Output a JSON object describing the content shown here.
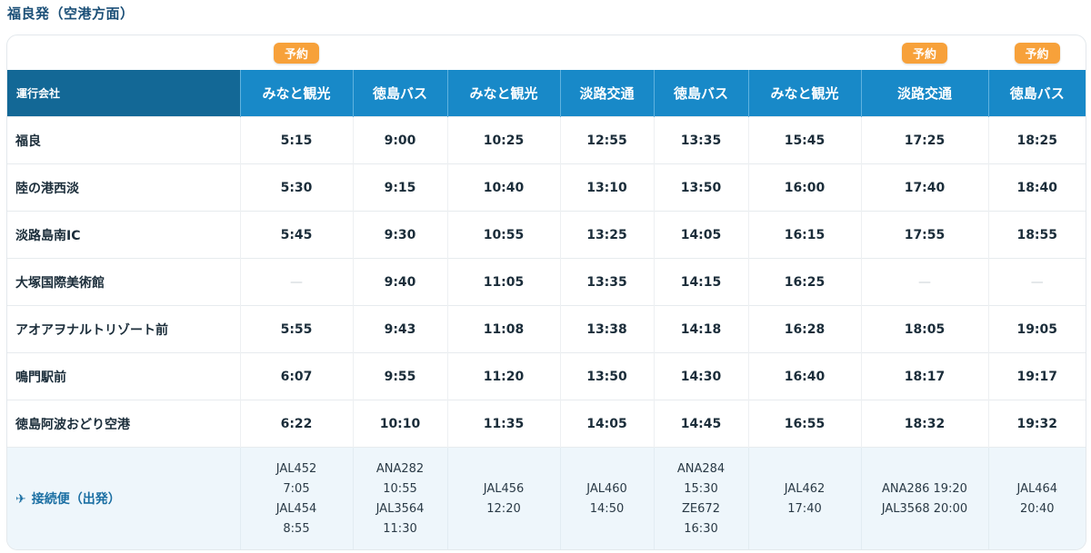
{
  "page_title": "福良発（空港方面）",
  "badge_label": "予約",
  "header": {
    "corner": "運行会社",
    "companies": [
      "みなと観光",
      "徳島バス",
      "みなと観光",
      "淡路交通",
      "徳島バス",
      "みなと観光",
      "淡路交通",
      "徳島バス"
    ],
    "reservable": [
      true,
      false,
      false,
      false,
      false,
      false,
      true,
      true
    ]
  },
  "rows": [
    {
      "stop": "福良",
      "times": [
        "5:15",
        "9:00",
        "10:25",
        "12:55",
        "13:35",
        "15:45",
        "17:25",
        "18:25"
      ]
    },
    {
      "stop": "陸の港西淡",
      "times": [
        "5:30",
        "9:15",
        "10:40",
        "13:10",
        "13:50",
        "16:00",
        "17:40",
        "18:40"
      ]
    },
    {
      "stop": "淡路島南IC",
      "times": [
        "5:45",
        "9:30",
        "10:55",
        "13:25",
        "14:05",
        "16:15",
        "17:55",
        "18:55"
      ]
    },
    {
      "stop": "大塚国際美術館",
      "times": [
        "—",
        "9:40",
        "11:05",
        "13:35",
        "14:15",
        "16:25",
        "—",
        "—"
      ]
    },
    {
      "stop": "アオアヲナルトリゾート前",
      "times": [
        "5:55",
        "9:43",
        "11:08",
        "13:38",
        "14:18",
        "16:28",
        "18:05",
        "19:05"
      ]
    },
    {
      "stop": "鳴門駅前",
      "times": [
        "6:07",
        "9:55",
        "11:20",
        "13:50",
        "14:30",
        "16:40",
        "18:17",
        "19:17"
      ]
    },
    {
      "stop": "徳島阿波おどり空港",
      "times": [
        "6:22",
        "10:10",
        "11:35",
        "14:05",
        "14:45",
        "16:55",
        "18:32",
        "19:32"
      ]
    }
  ],
  "connections": {
    "label": "接続便（出発）",
    "icon": "airplane-icon",
    "cells": [
      [
        "JAL452",
        "7:05",
        "JAL454",
        "8:55"
      ],
      [
        "ANA282",
        "10:55",
        "JAL3564",
        "11:30"
      ],
      [
        "JAL456",
        "12:20"
      ],
      [
        "JAL460",
        "14:50"
      ],
      [
        "ANA284",
        "15:30",
        "ZE672",
        "16:30"
      ],
      [
        "JAL462",
        "17:40"
      ],
      [
        "ANA286 19:20",
        "JAL3568 20:00"
      ],
      [
        "JAL464",
        "20:40"
      ]
    ]
  },
  "colors": {
    "header": "#1889c8",
    "corner": "#136896",
    "badge": "#f7a13a",
    "connection_bg": "#eef6fb"
  }
}
